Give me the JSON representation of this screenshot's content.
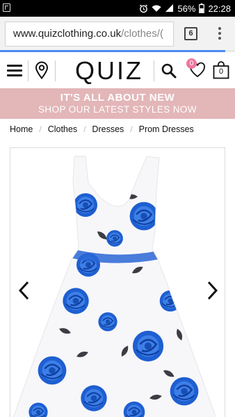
{
  "status_bar": {
    "battery_percent": "56%",
    "time": "22:28"
  },
  "browser": {
    "url_domain": "www.quizclothing.co.uk",
    "url_path": "/clothes/(",
    "tab_count": "6",
    "load_progress": 0.96
  },
  "header": {
    "logo": "QUIZ",
    "wishlist_count": "0",
    "bag_count": "0"
  },
  "promo": {
    "line1": "IT'S ALL ABOUT NEW",
    "line2": "SHOP OUR LATEST STYLES NOW"
  },
  "breadcrumb": {
    "items": [
      "Home",
      "Clothes",
      "Dresses",
      "Prom Dresses"
    ],
    "separator": "/"
  },
  "icons": {
    "app": "notification-app-icon",
    "alarm": "alarm-icon",
    "wifi": "wifi-icon",
    "signal": "signal-icon",
    "battery": "battery-icon",
    "menu": "hamburger-menu-icon",
    "store": "location-pin-icon",
    "search": "search-icon",
    "wishlist": "heart-icon",
    "bag": "shopping-bag-icon",
    "prev": "chevron-left-icon",
    "next": "chevron-right-icon"
  },
  "colors": {
    "promo_bg": "#e3b6b8",
    "badge": "#ee77a0",
    "progress": "#4a8af4",
    "dress_print": "#1e5fd1"
  }
}
